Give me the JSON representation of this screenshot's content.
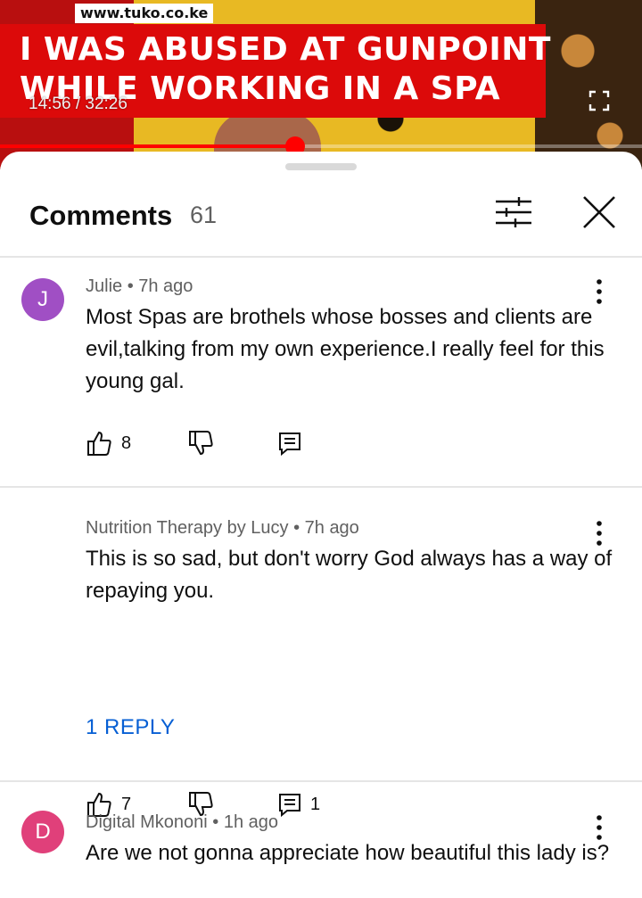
{
  "video": {
    "watermark": "www.tuko.co.ke",
    "headline_line1": "I WAS ABUSED AT GUNPOINT",
    "headline_line2": "WHILE WORKING IN A SPA",
    "timestamp": "14:56 / 32:26",
    "progress_percent": 46.0,
    "accent_color": "#ff0000"
  },
  "sheet": {
    "title": "Comments",
    "count": "61",
    "filter_icon": "sliders-icon",
    "close_icon": "close-icon"
  },
  "comments": [
    {
      "avatar_letter": "J",
      "avatar_color": "#a04fc4",
      "meta": "Julie • 7h ago",
      "text": "Most Spas are brothels whose bosses and clients are evil,talking from my own experience.I really feel for this young gal.",
      "likes": "8",
      "replies": ""
    },
    {
      "avatar_letter": "",
      "avatar_color": "#9fb07a",
      "meta": "Nutrition Therapy by Lucy • 7h ago",
      "text": "This is so sad, but don't worry God always has a way of repaying you.",
      "likes": "7",
      "replies": "1",
      "reply_link": "1 REPLY"
    },
    {
      "avatar_letter": "D",
      "avatar_color": "#e0407a",
      "meta": "Digital Mkononi • 1h ago",
      "text": "Are we not gonna appreciate how beautiful this lady is?",
      "likes": "",
      "replies": ""
    }
  ],
  "colors": {
    "link_blue": "#065fd4",
    "meta_gray": "#606060",
    "divider": "#e5e5e5"
  }
}
